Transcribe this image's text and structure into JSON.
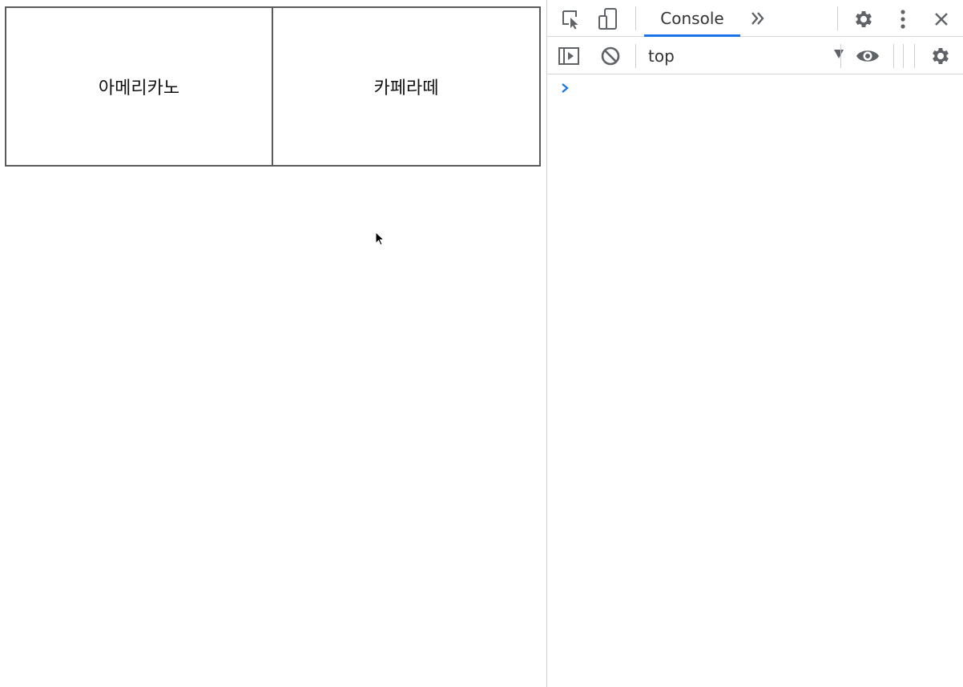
{
  "page": {
    "buttons": [
      {
        "label": "아메리카노"
      },
      {
        "label": "카페라떼"
      }
    ]
  },
  "devtools": {
    "tabs": [
      {
        "label": "Console",
        "active": true
      }
    ],
    "console_context": "top",
    "colors": {
      "active_tab_underline": "#1a73e8",
      "prompt": "#1a73e8",
      "icon": "#5f6368"
    },
    "icons": {
      "top_toolbar": [
        "inspect-element-icon",
        "device-toolbar-icon",
        "more-tabs-icon",
        "settings-icon",
        "kebab-menu-icon",
        "close-icon"
      ],
      "console_toolbar": [
        "show-sidebar-icon",
        "clear-console-icon",
        "eye-icon",
        "settings-icon"
      ]
    }
  }
}
